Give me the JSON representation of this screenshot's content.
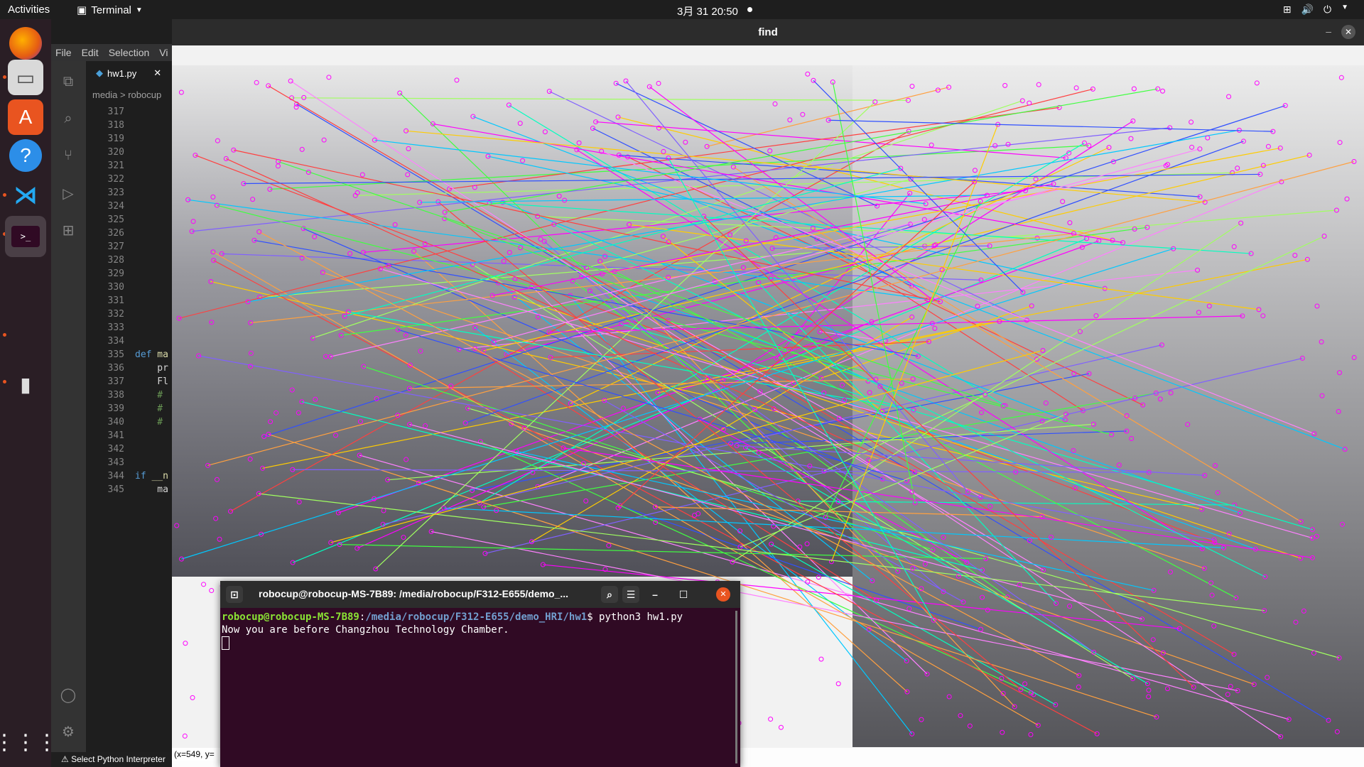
{
  "topbar": {
    "activities": "Activities",
    "app_name": "Terminal",
    "clock": "3月 31  20:50"
  },
  "dock": {
    "items": [
      "firefox",
      "files",
      "app-center",
      "help",
      "vscode",
      "terminal",
      "usb-drive",
      "show-apps"
    ]
  },
  "vscode": {
    "menu": [
      "File",
      "Edit",
      "Selection",
      "Vi"
    ],
    "tab_label": "hw1.py",
    "breadcrumb": "media > robocup",
    "line_numbers": [
      "317",
      "318",
      "319",
      "320",
      "321",
      "322",
      "323",
      "324",
      "325",
      "326",
      "327",
      "328",
      "329",
      "330",
      "331",
      "332",
      "333",
      "334",
      "335",
      "336",
      "337",
      "338",
      "339",
      "340",
      "341",
      "342",
      "343",
      "344",
      "345"
    ],
    "code_lines": [
      "",
      "",
      "",
      "",
      "",
      "",
      "",
      "",
      "",
      "",
      "",
      "",
      "",
      "",
      "",
      "",
      "",
      "",
      "def ma",
      "    pr",
      "    Fl",
      "    #",
      "    #",
      "    #",
      "",
      "",
      "",
      "if __n",
      "    ma"
    ],
    "status_text": "⚠ Select Python Interpreter"
  },
  "find_window": {
    "title": "find",
    "coord_readout": "(x=549, y="
  },
  "terminal": {
    "title": "robocup@robocup-MS-7B89: /media/robocup/F312-E655/demo_...",
    "prompt_user": "robocup@robocup-MS-7B89",
    "prompt_path": "/media/robocup/F312-E655/demo_HRI/hw1",
    "command": "$ python3 hw1.py",
    "output": "Now you are before Changzhou Technology Chamber."
  },
  "colors": {
    "terminal_bg": "#300a24",
    "dock_bg": "#2a1e25",
    "close_button": "#e95420"
  }
}
